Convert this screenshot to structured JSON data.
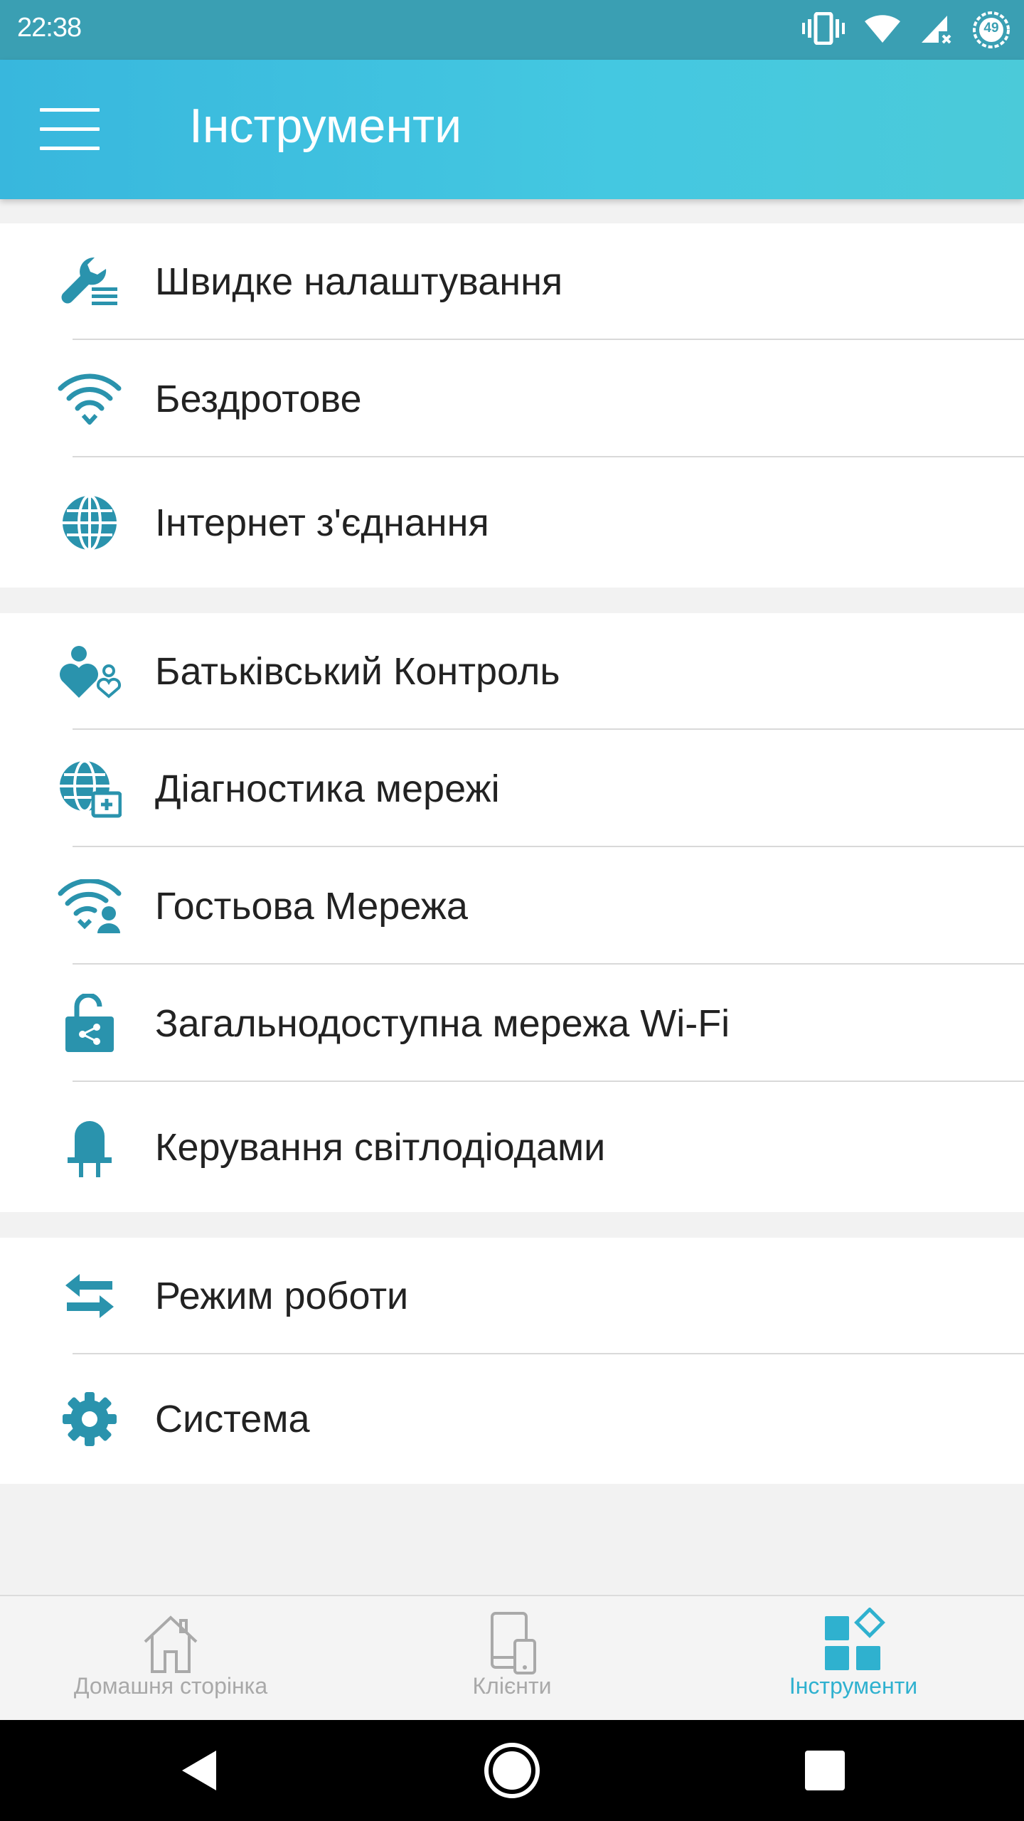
{
  "status_bar": {
    "time": "22:38",
    "battery_level": "49",
    "icons": [
      "vibrate-icon",
      "wifi-icon",
      "cell-signal-no-data-icon",
      "battery-icon"
    ]
  },
  "app_bar": {
    "title": "Інструменти",
    "menu_icon": "hamburger-menu-icon"
  },
  "groups": [
    {
      "items": [
        {
          "label": "Швидке налаштування",
          "icon": "wrench-list-icon"
        },
        {
          "label": "Бездротове",
          "icon": "wifi-icon"
        },
        {
          "label": "Інтернет з'єднання",
          "icon": "globe-icon"
        }
      ]
    },
    {
      "items": [
        {
          "label": "Батьківський Контроль",
          "icon": "parental-control-icon"
        },
        {
          "label": "Діагностика мережі",
          "icon": "globe-diagnostics-icon"
        },
        {
          "label": "Гостьова Мережа",
          "icon": "wifi-guest-icon"
        },
        {
          "label": "Загальнодоступна мережа Wi-Fi",
          "icon": "unlock-share-icon"
        },
        {
          "label": "Керування світлодіодами",
          "icon": "led-icon"
        }
      ]
    },
    {
      "items": [
        {
          "label": "Режим роботи",
          "icon": "swap-arrows-icon"
        },
        {
          "label": "Система",
          "icon": "gear-icon"
        }
      ]
    }
  ],
  "bottom_nav": {
    "tabs": [
      {
        "label": "Домашня сторінка",
        "icon": "home-icon",
        "active": false
      },
      {
        "label": "Клієнти",
        "icon": "devices-icon",
        "active": false
      },
      {
        "label": "Інструменти",
        "icon": "tools-grid-icon",
        "active": true
      }
    ]
  },
  "system_nav": {
    "buttons": [
      "back-icon",
      "home-circle-icon",
      "recents-icon"
    ]
  },
  "colors": {
    "accent": "#2a93ad",
    "app_bar": "#3fc2e0",
    "status_bar": "#3a9fb3",
    "active_tab": "#2fb1cf",
    "inactive_tab": "#a9a9a9"
  }
}
